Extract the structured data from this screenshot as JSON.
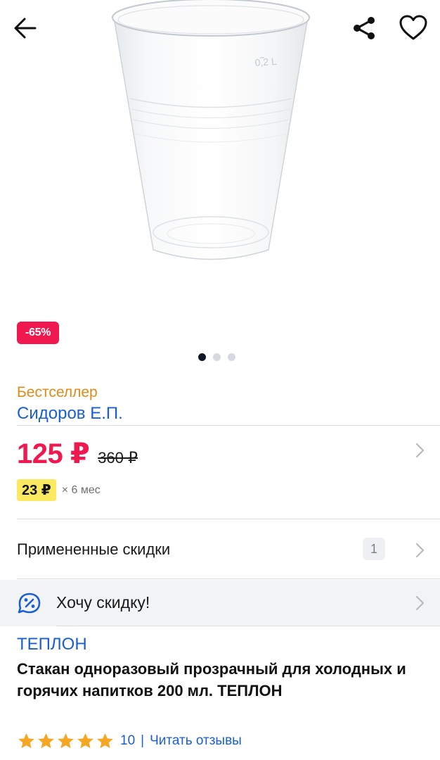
{
  "product": {
    "discount_badge": "-65%",
    "label": "Бестселлер",
    "seller": "Сидоров Е.П.",
    "brand": "ТЕПЛОН",
    "title": "Стакан одноразовый прозрачный для холодных и горячих напитков 200 мл. ТЕПЛОН",
    "cup_volume_mark": "0,2 L"
  },
  "gallery": {
    "total_slides": 3,
    "active_slide": 1
  },
  "price": {
    "current": "125 ₽",
    "old": "360 ₽",
    "installment_amount": "23 ₽",
    "installment_period": "× 6 мес"
  },
  "discounts": {
    "label": "Примененные скидки",
    "count": "1"
  },
  "want_discount": {
    "label": "Хочу скидку!"
  },
  "rating": {
    "stars": 5,
    "count": "10",
    "separator": "|",
    "reviews_link": "Читать отзывы"
  },
  "colors": {
    "accent_price": "#f0194f",
    "link_blue": "#1a5fd1",
    "bestseller_orange": "#e08a18",
    "installment_yellow": "#fbe95f",
    "star_orange": "#f5a623"
  }
}
